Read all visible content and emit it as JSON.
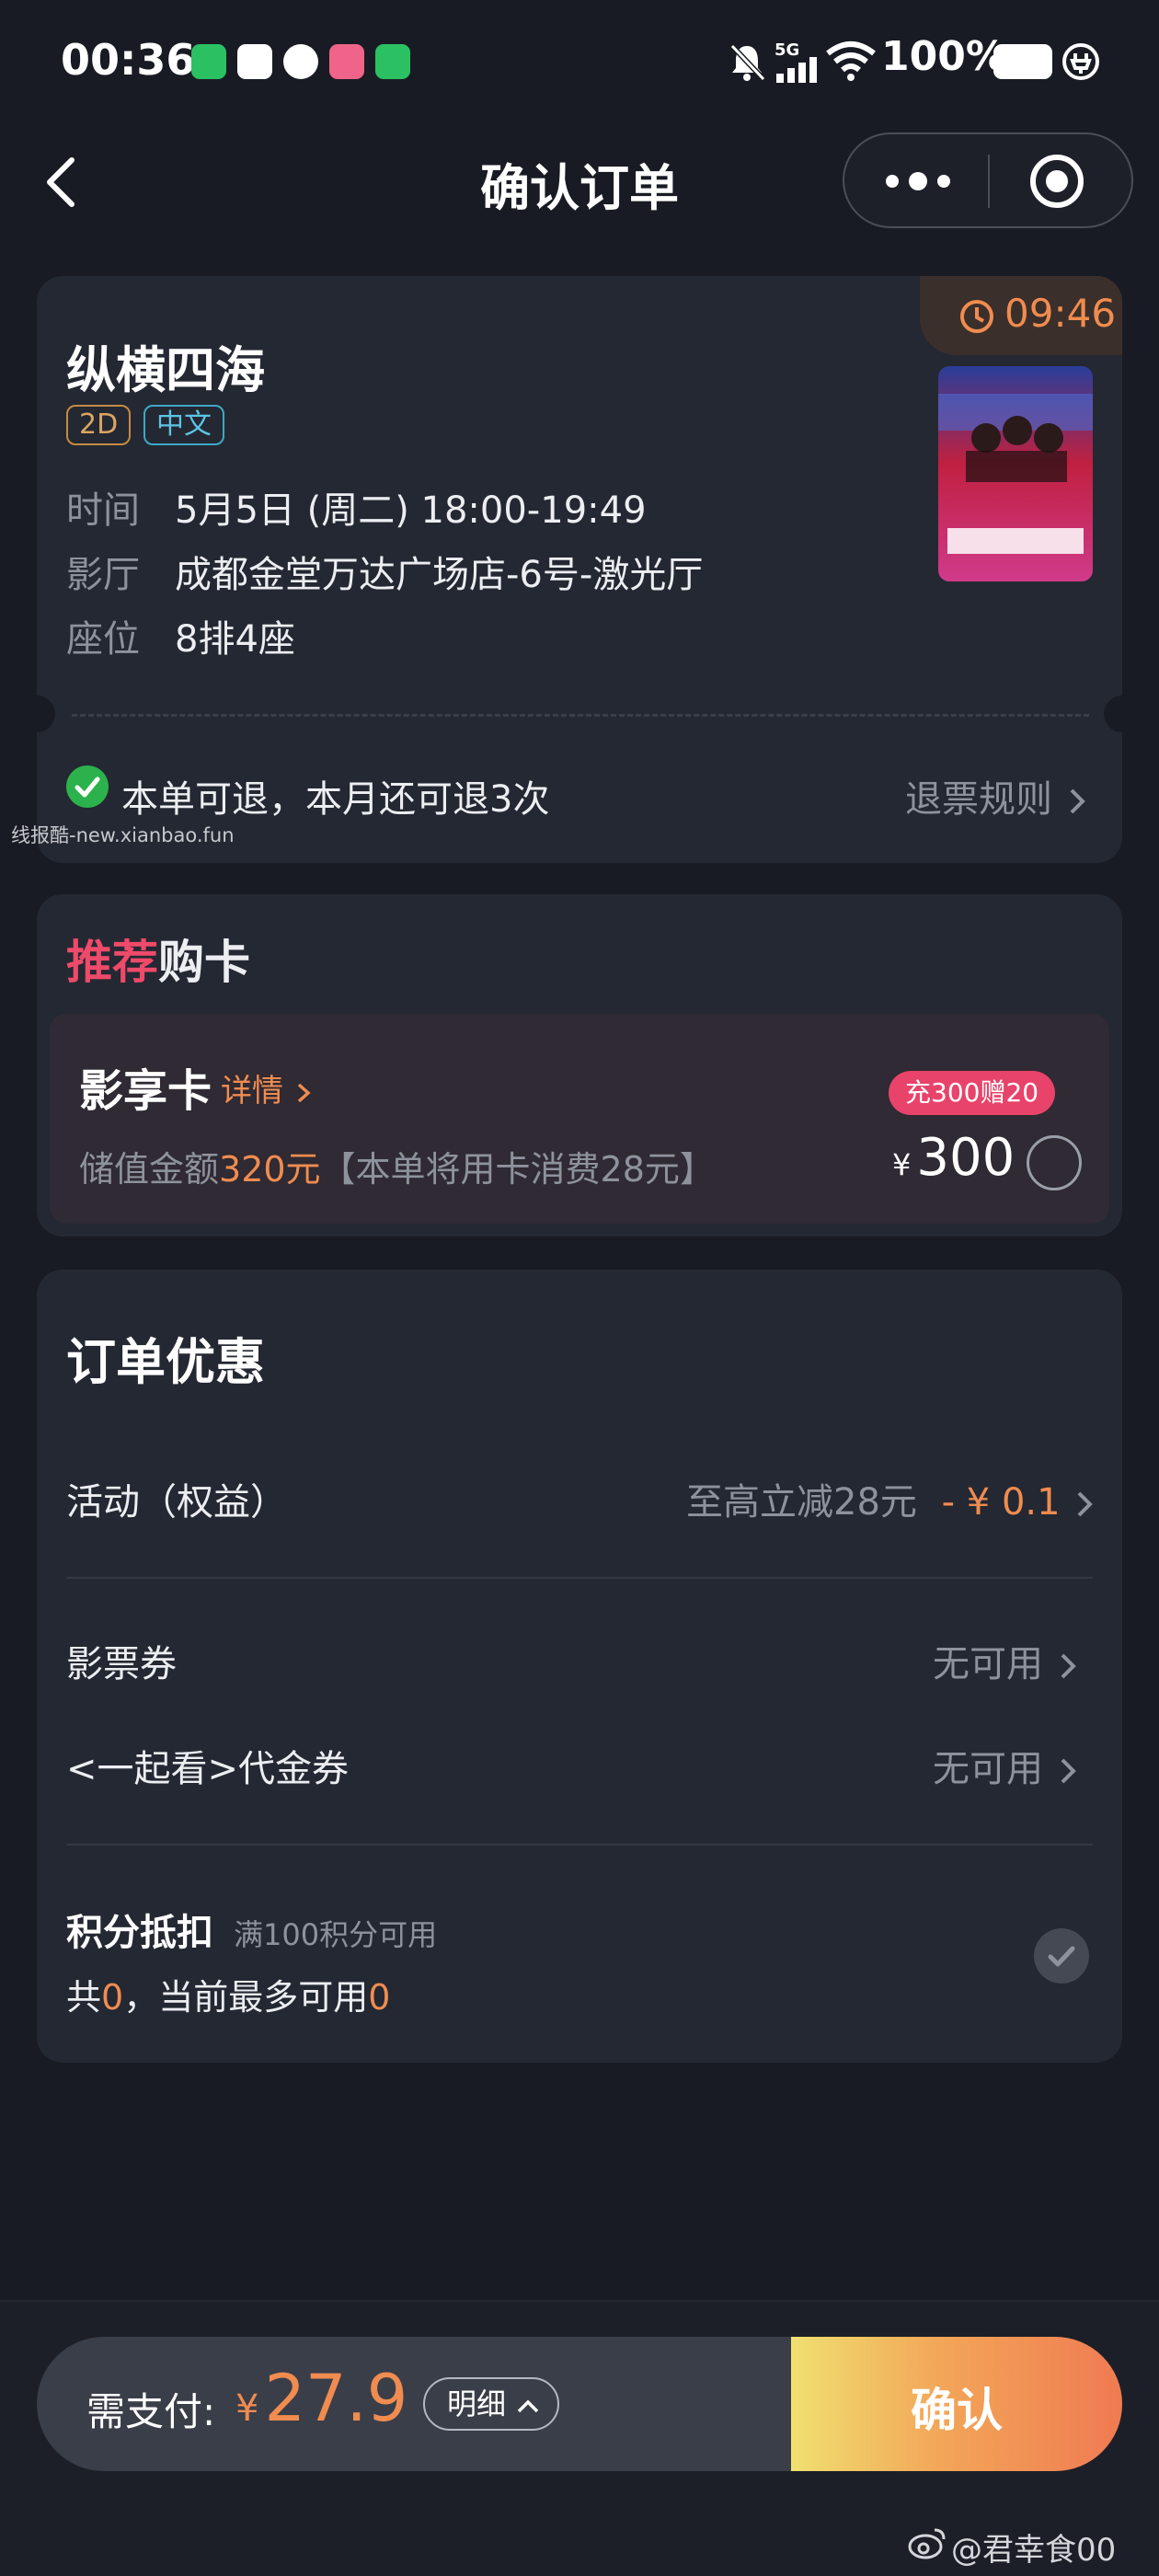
{
  "status_bar": {
    "time": "00:36",
    "network": "5G",
    "battery": "100%"
  },
  "nav": {
    "title": "确认订单"
  },
  "order": {
    "timer": "09:46",
    "movie_title": "纵横四海",
    "tags": [
      "2D",
      "中文"
    ],
    "info": [
      {
        "label": "时间",
        "value": "5月5日 (周二) 18:00-19:49"
      },
      {
        "label": "影厅",
        "value": "成都金堂万达广场店-6号-激光厅"
      },
      {
        "label": "座位",
        "value": "8排4座"
      }
    ],
    "refund_text": "本单可退，本月还可退3次",
    "refund_rule": "退票规则",
    "watermark": "线报酷-new.xianbao.fun"
  },
  "recommend": {
    "title_highlight": "推荐",
    "title_rest": "购卡",
    "card_name": "影享卡",
    "card_detail": "详情",
    "stored_prefix": "储值金额",
    "stored_amount": "320元",
    "stored_suffix": "【本单将用卡消费28元】",
    "promo": "充300赠20",
    "currency": "¥",
    "price": "300"
  },
  "discounts": {
    "title": "订单优惠",
    "activity_label": "活动（权益）",
    "activity_hint": "至高立减28元",
    "activity_value": "- ¥ 0.1",
    "coupon_label": "影票券",
    "coupon_value": "无可用",
    "voucher_label": "<一起看>代金券",
    "voucher_value": "无可用",
    "points_label": "积分抵扣",
    "points_condition": "满100积分可用",
    "points_total_prefix": "共",
    "points_total": "0",
    "points_mid": "，当前最多可用",
    "points_max": "0"
  },
  "footer": {
    "pay_label": "需支付:",
    "currency": "¥",
    "amount": "27.9",
    "detail_label": "明细",
    "confirm_label": "确认",
    "author": "@君幸食00"
  },
  "colors": {
    "accent_orange": "#f08c50",
    "accent_pink": "#e8436a",
    "success_green": "#2bb24c",
    "background": "#181b23",
    "card": "#242832"
  }
}
